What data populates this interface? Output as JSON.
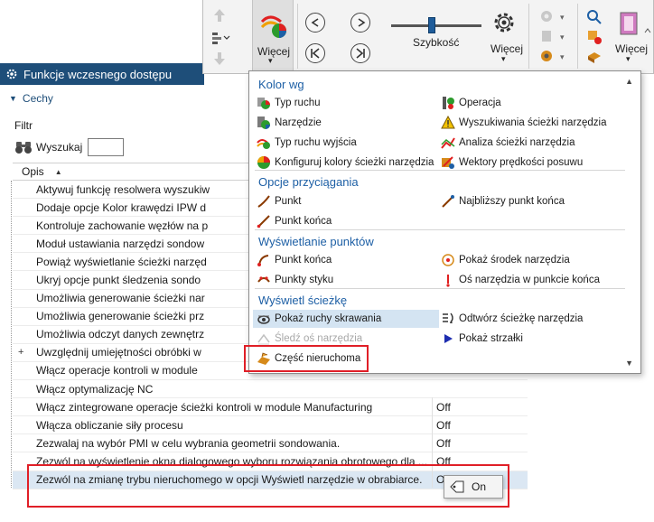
{
  "panel": {
    "title": "Funkcje wczesnego dostępu",
    "section": "Cechy",
    "filter_label": "Filtr",
    "search_label": "Wyszukaj",
    "search_value": "",
    "column_header": "Opis"
  },
  "rows": [
    {
      "desc": "Aktywuj funkcję resolwera wyszukiw",
      "val": ""
    },
    {
      "desc": "Dodaje opcje Kolor krawędzi IPW d",
      "val": ""
    },
    {
      "desc": "Kontroluje zachowanie węzłów na p",
      "val": ""
    },
    {
      "desc": "Moduł ustawiania narzędzi sondow",
      "val": ""
    },
    {
      "desc": "Powiąż wyświetlanie ścieżki narzęd",
      "val": ""
    },
    {
      "desc": "Ukryj opcje punkt śledzenia sondo",
      "val": ""
    },
    {
      "desc": "Umożliwia generowanie ścieżki nar",
      "val": ""
    },
    {
      "desc": "Umożliwia generowanie ścieżki prz",
      "val": ""
    },
    {
      "desc": "Umożliwia odczyt danych zewnętrz",
      "val": ""
    },
    {
      "desc": "Uwzględnij umiejętności obróbki w",
      "val": "",
      "expandable": "+"
    },
    {
      "desc": "Włącz operacje kontroli w module",
      "val": ""
    },
    {
      "desc": "Włącz optymalizację NC",
      "val": ""
    },
    {
      "desc": "Włącz zintegrowane operacje ścieżki kontroli w module Manufacturing",
      "val": "Off"
    },
    {
      "desc": "Włącza obliczanie siły procesu",
      "val": "Off"
    },
    {
      "desc": "Zezwalaj na wybór PMI w celu wybrania geometrii sondowania.",
      "val": "Off"
    },
    {
      "desc": "Zezwól na wyświetlenie okna dialogowego wyboru rozwiązania obrotowego dla ...",
      "val": "Off"
    },
    {
      "desc": "Zezwól na zmianę trybu nieruchomego w opcji Wyświetl narzędzie w obrabiarce.",
      "val": "Off",
      "selected": true
    }
  ],
  "ribbon": {
    "more_label_1": "Więcej",
    "speed_label": "Szybkość",
    "more_label_2": "Więcej",
    "more_label_3": "Więcej"
  },
  "dropdown": {
    "categories": [
      "Kolor wg",
      "Opcje przyciągania",
      "Wyświetlanie punktów",
      "Wyświetl ścieżkę"
    ],
    "kolor": {
      "left": [
        "Typ ruchu",
        "Narzędzie",
        "Typ ruchu wyjścia",
        "Konfiguruj kolory ścieżki narzędzia"
      ],
      "right": [
        "Operacja",
        "Wyszukiwania ścieżki narzędzia",
        "Analiza ścieżki narzędzia",
        "Wektory prędkości posuwu"
      ]
    },
    "snap": {
      "left": [
        "Punkt",
        "Punkt końca"
      ],
      "right": [
        "Najbliższy punkt końca"
      ]
    },
    "points": {
      "left": [
        "Punkt końca",
        "Punkty styku"
      ],
      "right": [
        "Pokaż środek narzędzia",
        "Oś narzędzia w punkcie końca"
      ]
    },
    "path": {
      "left": [
        "Pokaż ruchy skrawania",
        "Śledź oś narzędzia",
        "Część nieruchoma"
      ],
      "right": [
        "Odtwórz ścieżkę narzędzia",
        "Pokaż strzałki"
      ]
    }
  },
  "value_popup": {
    "label": "On"
  },
  "colors": {
    "accent": "#1e4e79",
    "highlight": "#e01f27",
    "selection": "#dbe7f3"
  }
}
